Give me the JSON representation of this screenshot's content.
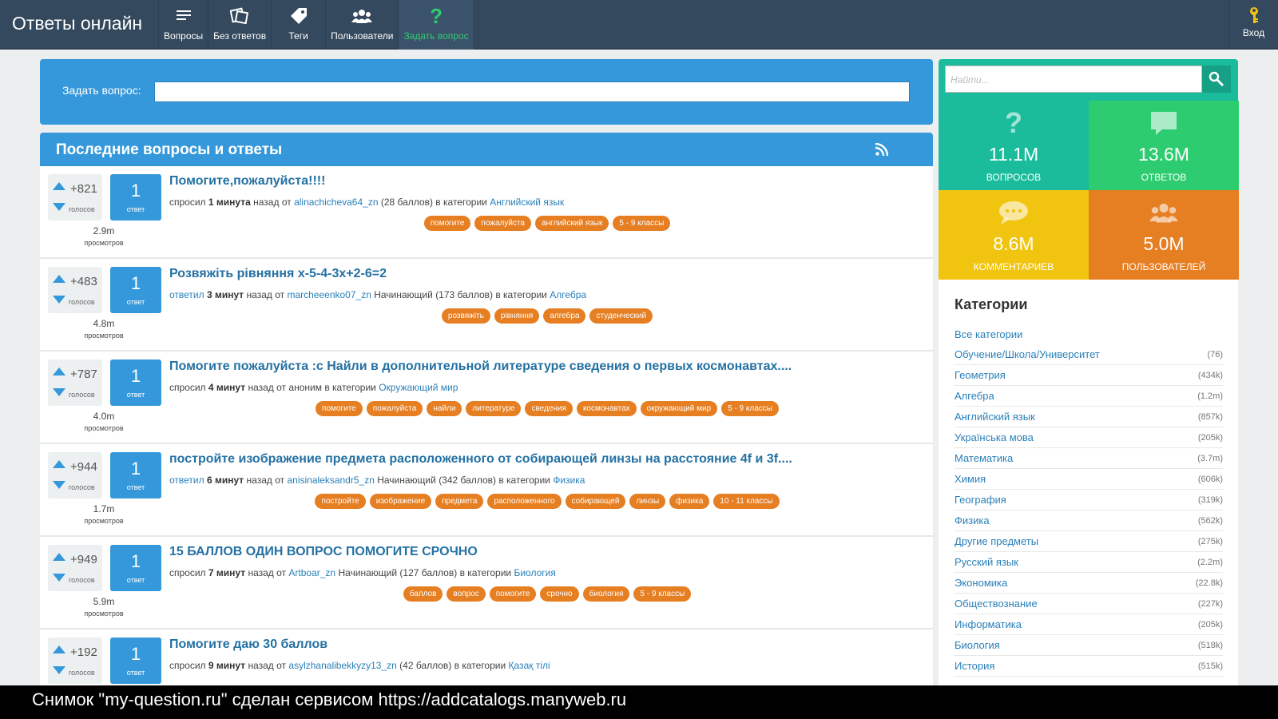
{
  "header": {
    "brand": "Ответы онлайн",
    "nav": [
      {
        "label": "Вопросы",
        "icon": "list-icon"
      },
      {
        "label": "Без ответов",
        "icon": "unanswered-icon"
      },
      {
        "label": "Теги",
        "icon": "tag-icon"
      },
      {
        "label": "Пользователи",
        "icon": "users-icon"
      },
      {
        "label": "Задать вопрос",
        "icon": "question-icon"
      }
    ],
    "login": "Вход"
  },
  "ask": {
    "label": "Задать вопрос:",
    "value": ""
  },
  "feed": {
    "title": "Последние вопросы и ответы",
    "questions": [
      {
        "votes": "+821",
        "votes_label": "голосов",
        "answers": "1",
        "answers_label": "ответ",
        "views": "2.9m",
        "views_label": "просмотров",
        "title": "Помогите,пожалуйста!!!!",
        "action": "спросил",
        "time": "1 минута",
        "ago": "назад от",
        "user": "alinachicheva64_zn",
        "rank": "",
        "points": "(28 баллов) в категории",
        "category": "Английский язык",
        "tags": [
          "помогите",
          "пожалуйста",
          "английский язык",
          "5 - 9 классы"
        ]
      },
      {
        "votes": "+483",
        "votes_label": "голосов",
        "answers": "1",
        "answers_label": "ответ",
        "views": "4.8m",
        "views_label": "просмотров",
        "title": "Розвяжіть рівняння x-5-4-3x+2-6=2",
        "action": "ответил",
        "time": "3 минут",
        "ago": "назад от",
        "user": "marcheeenko07_zn",
        "rank": "Начинающий",
        "points": "(173 баллов) в категории",
        "category": "Алгебра",
        "tags": [
          "розвяжіть",
          "рівняння",
          "алгебра",
          "студенческий"
        ]
      },
      {
        "votes": "+787",
        "votes_label": "голосов",
        "answers": "1",
        "answers_label": "ответ",
        "views": "4.0m",
        "views_label": "просмотров",
        "title": "Помогите пожалуйста :с Найли в дополнительной литературе сведения о первых космонавтах....",
        "action": "спросил",
        "time": "4 минут",
        "ago": "назад от",
        "user": "",
        "rank": "аноним",
        "points": "в категории",
        "category": "Окружающий мир",
        "tags": [
          "помогите",
          "пожалуйста",
          "найли",
          "литературе",
          "сведения",
          "космонавтах",
          "окружающий мир",
          "5 - 9 классы"
        ]
      },
      {
        "votes": "+944",
        "votes_label": "голосов",
        "answers": "1",
        "answers_label": "ответ",
        "views": "1.7m",
        "views_label": "просмотров",
        "title": "постройте изображение предмета расположенного от собирающей линзы на расстояние 4f и 3f....",
        "action": "ответил",
        "time": "6 минут",
        "ago": "назад от",
        "user": "anisinaleksandr5_zn",
        "rank": "Начинающий",
        "points": "(342 баллов) в категории",
        "category": "Физика",
        "tags": [
          "постройте",
          "изображение",
          "предмета",
          "расположенного",
          "собирающей",
          "линзы",
          "физика",
          "10 - 11 классы"
        ]
      },
      {
        "votes": "+949",
        "votes_label": "голосов",
        "answers": "1",
        "answers_label": "ответ",
        "views": "5.9m",
        "views_label": "просмотров",
        "title": "15 БАЛЛОВ ОДИН ВОПРОС ПОМОГИТЕ СРОЧНО",
        "action": "спросил",
        "time": "7 минут",
        "ago": "назад от",
        "user": "Artboar_zn",
        "rank": "Начинающий",
        "points": "(127 баллов) в категории",
        "category": "Биология",
        "tags": [
          "баллов",
          "вопрос",
          "помогите",
          "срочно",
          "биология",
          "5 - 9 классы"
        ]
      },
      {
        "votes": "+192",
        "votes_label": "голосов",
        "answers": "1",
        "answers_label": "ответ",
        "views": "",
        "views_label": "",
        "title": "Помогите даю 30 баллов",
        "action": "спросил",
        "time": "9 минут",
        "ago": "назад от",
        "user": "asylzhanalibekkyzy13_zn",
        "rank": "",
        "points": "(42 баллов) в категории",
        "category": "Қазақ тілі",
        "tags": []
      }
    ]
  },
  "sidebar": {
    "search_placeholder": "Найти...",
    "stats": [
      {
        "value": "11.1M",
        "label": "ВОПРОСОВ",
        "icon": "question-icon"
      },
      {
        "value": "13.6M",
        "label": "ОТВЕТОВ",
        "icon": "answer-bubble-icon"
      },
      {
        "value": "8.6M",
        "label": "КОММЕНТАРИЕВ",
        "icon": "comment-icon"
      },
      {
        "value": "5.0M",
        "label": "ПОЛЬЗОВАТЕЛЕЙ",
        "icon": "users-icon"
      }
    ],
    "categories_title": "Категории",
    "categories": [
      {
        "name": "Все категории",
        "count": ""
      },
      {
        "name": "Обучение/Школа/Университет",
        "count": "(76)"
      },
      {
        "name": "Геометрия",
        "count": "(434k)"
      },
      {
        "name": "Алгебра",
        "count": "(1.2m)"
      },
      {
        "name": "Английский язык",
        "count": "(857k)"
      },
      {
        "name": "Українська мова",
        "count": "(205k)"
      },
      {
        "name": "Математика",
        "count": "(3.7m)"
      },
      {
        "name": "Химия",
        "count": "(606k)"
      },
      {
        "name": "География",
        "count": "(319k)"
      },
      {
        "name": "Физика",
        "count": "(562k)"
      },
      {
        "name": "Другие предметы",
        "count": "(275k)"
      },
      {
        "name": "Русский язык",
        "count": "(2.2m)"
      },
      {
        "name": "Экономика",
        "count": "(22.8k)"
      },
      {
        "name": "Обществознание",
        "count": "(227k)"
      },
      {
        "name": "Информатика",
        "count": "(205k)"
      },
      {
        "name": "Биология",
        "count": "(518k)"
      },
      {
        "name": "История",
        "count": "(515k)"
      }
    ]
  },
  "footer": {
    "caption": "Снимок \"my-question.ru\" сделан сервисом https://addcatalogs.manyweb.ru"
  },
  "colors": {
    "nav": "#34495e",
    "primary": "#3498db",
    "tag": "#e67e22",
    "teal": "#1abc9c",
    "green": "#2ecc71",
    "yellow": "#f1c40f"
  }
}
